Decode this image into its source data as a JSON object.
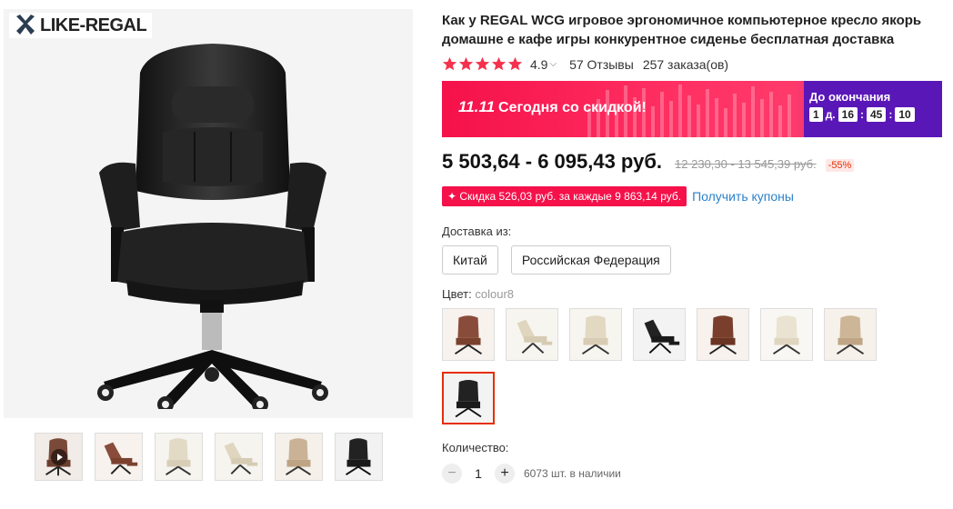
{
  "brand": {
    "logo_text": "LIKE-REGAL"
  },
  "product": {
    "title": "Как у REGAL WCG игровое эргономичное компьютерное кресло якорь домашне е кафе игры конкурентное сиденье бесплатная доставка",
    "rating": {
      "score": "4.9",
      "stars": 5,
      "reviews": "57 Отзывы",
      "orders": "257 заказа(ов)"
    },
    "banner": {
      "promo_prefix": "11.11",
      "promo_text": "Сегодня со скидкой!",
      "until_label": "До окончания",
      "days": "1",
      "days_label": "д.",
      "hours": "16",
      "minutes": "45",
      "seconds": "10"
    },
    "price": "5 503,64 - 6 095,43 руб.",
    "old_price": "12 230,30 - 13 545,39 руб.",
    "discount": "-55%",
    "coupon": {
      "text": "✦ Скидка 526,03 руб. за каждые 9 863,14 руб.",
      "link": "Получить купоны"
    },
    "shipping": {
      "label": "Доставка из:",
      "options": [
        "Китай",
        "Российская Федерация"
      ]
    },
    "color": {
      "label": "Цвет:",
      "value": "colour8",
      "swatches": [
        "brown",
        "beige-reclined",
        "beige",
        "black-reclined",
        "brown-dark",
        "beige-light",
        "beige-2",
        "black"
      ]
    },
    "quantity": {
      "label": "Количество:",
      "value": "1",
      "minus": "−",
      "plus": "+",
      "stock": "6073 шт. в наличии"
    }
  },
  "colors": {
    "accent": "#e62e04",
    "promo": "#f5114a",
    "link": "#2c82c9",
    "timer_bg": "#5a17b8",
    "star": "#f5314d"
  }
}
